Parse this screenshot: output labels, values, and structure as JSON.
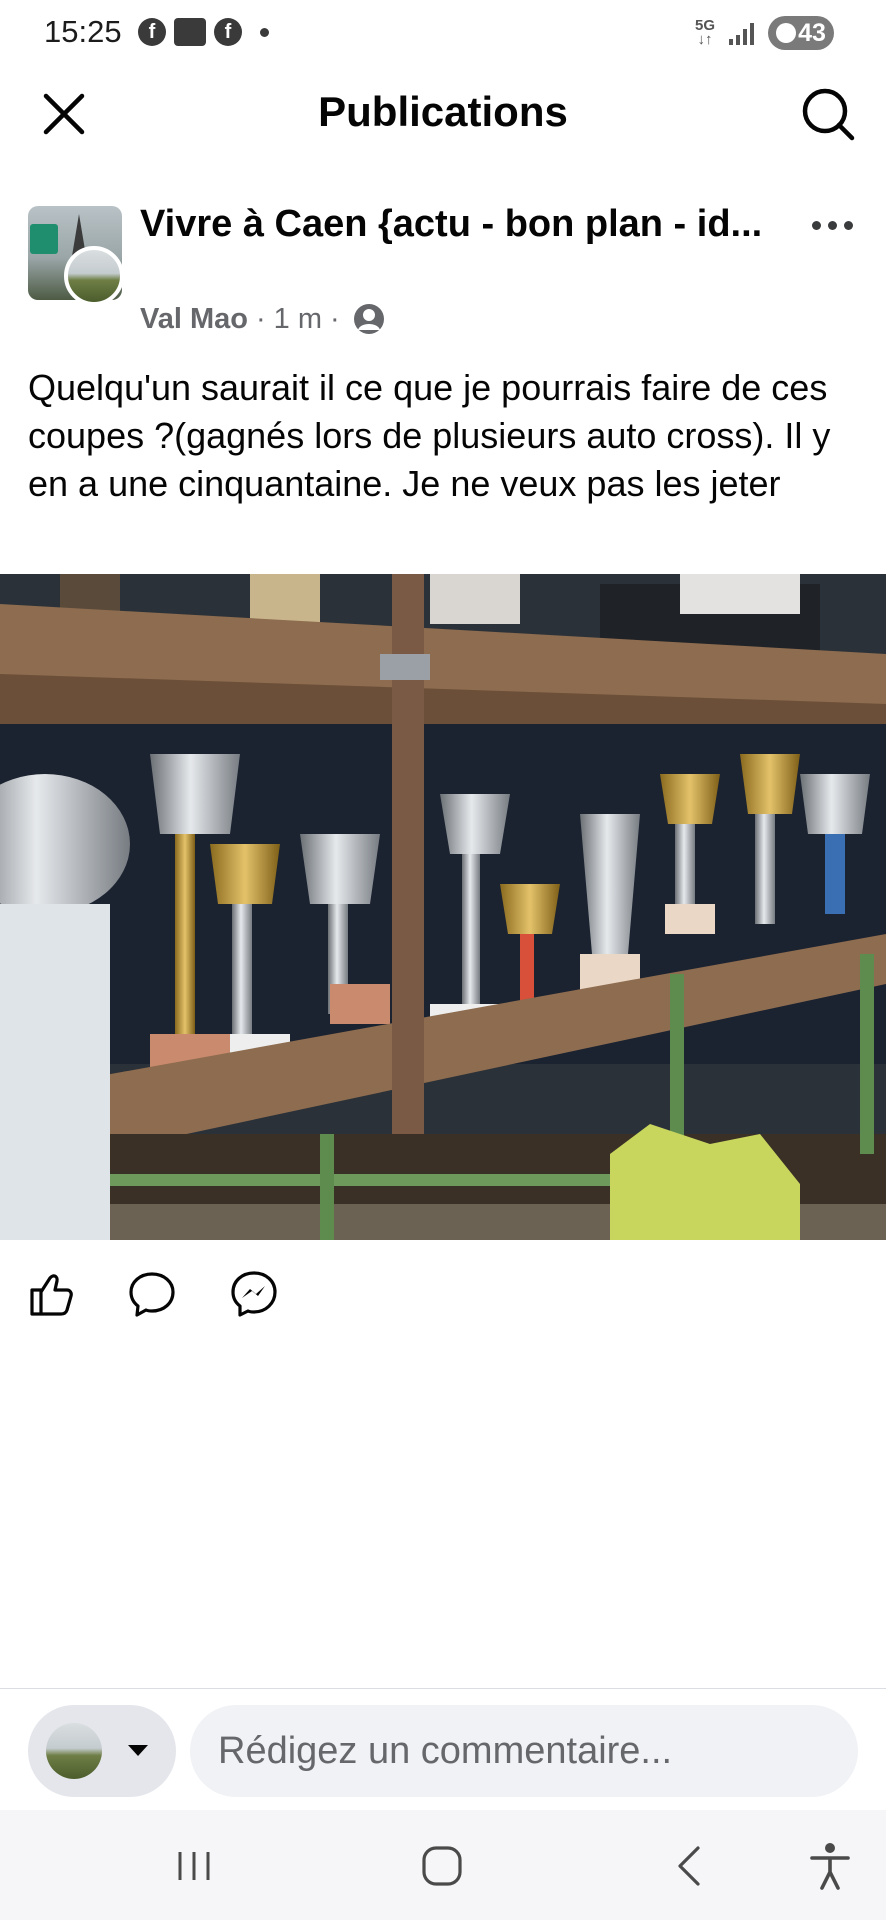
{
  "status_bar": {
    "time": "15:25",
    "app_icons": [
      "facebook-icon",
      "photos-icon",
      "facebook-icon"
    ],
    "network": "5G",
    "battery": "43"
  },
  "header": {
    "title": "Publications",
    "close_icon": "close-icon",
    "search_icon": "search-icon"
  },
  "post": {
    "group_name": "Vivre à Caen {actu - bon plan - id...",
    "author": "Val Mao",
    "time_ago": "1 m",
    "separator": "·",
    "privacy_icon": "members-icon",
    "text": "Quelqu'un saurait il ce que je pourrais faire de ces coupes ?(gagnés lors de plusieurs auto cross). Il y en a une cinquantaine. Je ne veux pas les jeter"
  },
  "actions": {
    "like_icon": "thumbs-up-icon",
    "comment_icon": "comment-icon",
    "share_icon": "messenger-icon"
  },
  "composer": {
    "placeholder": "Rédigez un commentaire..."
  },
  "nav_bar": {
    "recents_icon": "recents-icon",
    "home_icon": "home-icon",
    "back_icon": "back-icon",
    "accessibility_icon": "accessibility-icon"
  },
  "colors": {
    "text": "#050505",
    "secondary_text": "#65676b",
    "input_bg": "#f0f2f5"
  }
}
